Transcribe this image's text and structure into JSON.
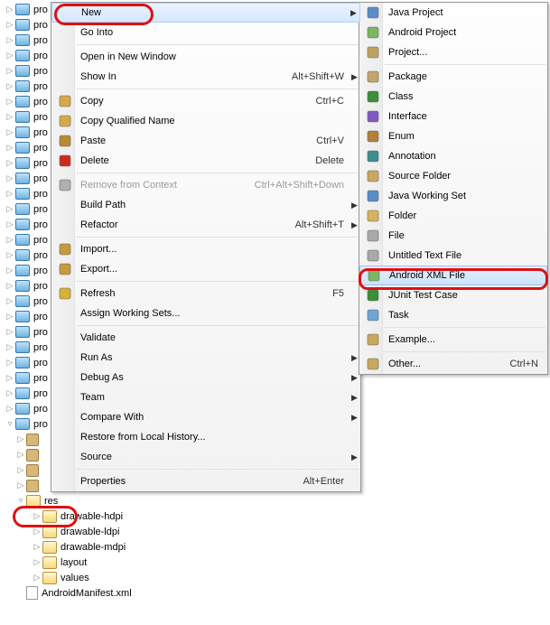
{
  "tree": {
    "pro_truncated": "pro",
    "res_label": "res",
    "children": [
      {
        "label": "drawable-hdpi"
      },
      {
        "label": "drawable-ldpi"
      },
      {
        "label": "drawable-mdpi"
      },
      {
        "label": "layout"
      },
      {
        "label": "values"
      }
    ],
    "manifest": "AndroidManifest.xml"
  },
  "menu1": {
    "items": [
      {
        "label": "New",
        "arrow": true,
        "highlight": true
      },
      {
        "label": "Go Into"
      },
      {
        "sep": true
      },
      {
        "label": "Open in New Window"
      },
      {
        "label": "Show In",
        "accel": "Alt+Shift+W",
        "arrow": true
      },
      {
        "sep": true
      },
      {
        "label": "Copy",
        "accel": "Ctrl+C",
        "icon": "copy-icon"
      },
      {
        "label": "Copy Qualified Name",
        "icon": "copy-qn-icon"
      },
      {
        "label": "Paste",
        "accel": "Ctrl+V",
        "icon": "paste-icon"
      },
      {
        "label": "Delete",
        "accel": "Delete",
        "icon": "delete-icon"
      },
      {
        "sep": true
      },
      {
        "label": "Remove from Context",
        "accel": "Ctrl+Alt+Shift+Down",
        "disabled": true,
        "icon": "remove-ctx-icon"
      },
      {
        "label": "Build Path",
        "arrow": true
      },
      {
        "label": "Refactor",
        "accel": "Alt+Shift+T",
        "arrow": true
      },
      {
        "sep": true
      },
      {
        "label": "Import...",
        "icon": "import-icon"
      },
      {
        "label": "Export...",
        "icon": "export-icon"
      },
      {
        "sep": true
      },
      {
        "label": "Refresh",
        "accel": "F5",
        "icon": "refresh-icon"
      },
      {
        "label": "Assign Working Sets..."
      },
      {
        "sep": true
      },
      {
        "label": "Validate"
      },
      {
        "label": "Run As",
        "arrow": true
      },
      {
        "label": "Debug As",
        "arrow": true
      },
      {
        "label": "Team",
        "arrow": true
      },
      {
        "label": "Compare With",
        "arrow": true
      },
      {
        "label": "Restore from Local History..."
      },
      {
        "label": "Source",
        "arrow": true
      },
      {
        "sep": true
      },
      {
        "label": "Properties",
        "accel": "Alt+Enter"
      }
    ]
  },
  "menu2": {
    "items": [
      {
        "label": "Java Project",
        "icon": "java-project-icon"
      },
      {
        "label": "Android Project",
        "icon": "android-project-icon"
      },
      {
        "label": "Project...",
        "icon": "project-icon"
      },
      {
        "sep": true
      },
      {
        "label": "Package",
        "icon": "package-icon"
      },
      {
        "label": "Class",
        "icon": "class-icon"
      },
      {
        "label": "Interface",
        "icon": "interface-icon"
      },
      {
        "label": "Enum",
        "icon": "enum-icon"
      },
      {
        "label": "Annotation",
        "icon": "annotation-icon"
      },
      {
        "label": "Source Folder",
        "icon": "source-folder-icon"
      },
      {
        "label": "Java Working Set",
        "icon": "workingset-icon"
      },
      {
        "label": "Folder",
        "icon": "folder-icon"
      },
      {
        "label": "File",
        "icon": "file-icon"
      },
      {
        "label": "Untitled Text File",
        "icon": "textfile-icon"
      },
      {
        "label": "Android XML File",
        "icon": "android-xml-icon",
        "selected": true
      },
      {
        "label": "JUnit Test Case",
        "icon": "junit-icon"
      },
      {
        "label": "Task",
        "icon": "task-icon"
      },
      {
        "sep": true
      },
      {
        "label": "Example...",
        "icon": "example-icon"
      },
      {
        "sep": true
      },
      {
        "label": "Other...",
        "accel": "Ctrl+N",
        "icon": "other-icon"
      }
    ]
  }
}
